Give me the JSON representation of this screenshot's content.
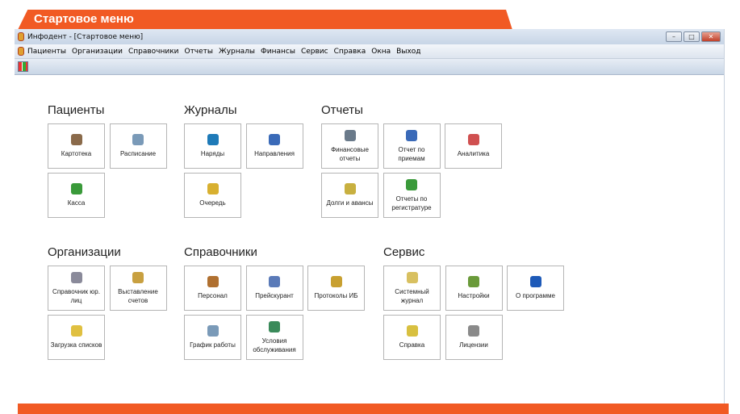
{
  "banner": {
    "title": "Стартовое меню"
  },
  "window": {
    "title": "Инфодент - [Стартовое меню]",
    "controls": [
      "minimize",
      "maximize",
      "close"
    ]
  },
  "menu": [
    "Пациенты",
    "Организации",
    "Справочники",
    "Отчеты",
    "Журналы",
    "Финансы",
    "Сервис",
    "Справка",
    "Окна",
    "Выход"
  ],
  "toolbar": {
    "icon": "grid-icon"
  },
  "sections": {
    "patients": {
      "title": "Пациенты",
      "items": [
        {
          "label": "Картотека",
          "icon": "card-file-icon",
          "color": "#8a6a4a"
        },
        {
          "label": "Расписание",
          "icon": "schedule-clock-icon",
          "color": "#7a9ab8"
        },
        {
          "label": "Касса",
          "icon": "cash-icon",
          "color": "#3a9a3a"
        }
      ]
    },
    "journals": {
      "title": "Журналы",
      "items": [
        {
          "label": "Наряды",
          "icon": "book-icon",
          "color": "#1e7ab8"
        },
        {
          "label": "Направления",
          "icon": "referral-icon",
          "color": "#3a6ab8"
        },
        {
          "label": "Очередь",
          "icon": "queue-icon",
          "color": "#d8b030"
        }
      ]
    },
    "reports": {
      "title": "Отчеты",
      "items": [
        {
          "label": "Финансовые отчеты",
          "icon": "printer-icon",
          "color": "#6a7a8a"
        },
        {
          "label": "Отчет по приемам",
          "icon": "ruler-icon",
          "color": "#3a6ab8"
        },
        {
          "label": "Аналитика",
          "icon": "pie-chart-icon",
          "color": "#d05050"
        },
        {
          "label": "Долги и авансы",
          "icon": "chart-doc-icon",
          "color": "#c8b040"
        },
        {
          "label": "Отчеты по регистратуре",
          "icon": "user-checklist-icon",
          "color": "#3a9a3a"
        }
      ]
    },
    "orgs": {
      "title": "Организации",
      "items": [
        {
          "label": "Справочник юр. лиц",
          "icon": "building-icon",
          "color": "#8a8a9a"
        },
        {
          "label": "Выставление счетов",
          "icon": "invoice-icon",
          "color": "#c8a040"
        },
        {
          "label": "Загрузка списков",
          "icon": "folder-icon",
          "color": "#e0c040"
        }
      ]
    },
    "refs": {
      "title": "Справочники",
      "items": [
        {
          "label": "Персонал",
          "icon": "person-icon",
          "color": "#b07030"
        },
        {
          "label": "Прейскурант",
          "icon": "price-list-icon",
          "color": "#5a7ab8"
        },
        {
          "label": "Протоколы ИБ",
          "icon": "protocol-book-icon",
          "color": "#c8a030"
        },
        {
          "label": "График работы",
          "icon": "work-schedule-icon",
          "color": "#7a9ab8"
        },
        {
          "label": "Условия обслуживания",
          "icon": "conditions-icon",
          "color": "#3a8a5a"
        }
      ]
    },
    "service": {
      "title": "Сервис",
      "items": [
        {
          "label": "Системный журнал",
          "icon": "system-log-icon",
          "color": "#d8c060"
        },
        {
          "label": "Настройки",
          "icon": "settings-icon",
          "color": "#6a9a3a"
        },
        {
          "label": "О программе",
          "icon": "info-icon",
          "color": "#1e5ab8"
        },
        {
          "label": "Справка",
          "icon": "help-icon",
          "color": "#d8c040"
        },
        {
          "label": "Лицензии",
          "icon": "license-icon",
          "color": "#8a8a8a"
        }
      ]
    }
  },
  "colors": {
    "accent": "#f15a24"
  }
}
